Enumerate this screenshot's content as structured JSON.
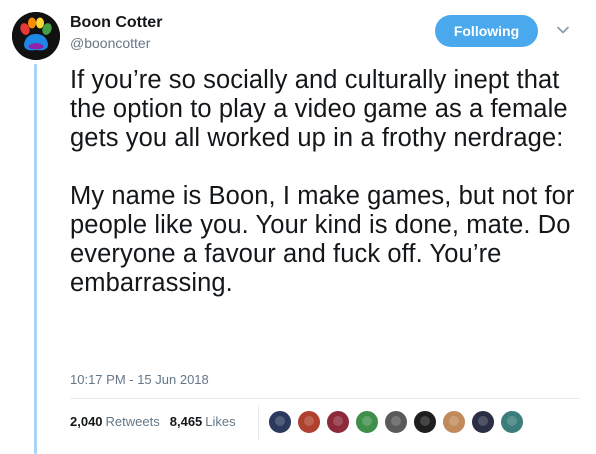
{
  "user": {
    "name": "Boon Cotter",
    "handle": "@booncotter"
  },
  "follow_button_label": "Following",
  "tweet": {
    "text": "If you’re so socially and culturally inept that the option to play a video game as a female gets you all worked up in a frothy nerdrage:\n\nMy name is Boon, I make games, but not for people like you. Your kind is done, mate. Do everyone a favour and fuck off. You’re embarrassing.",
    "timestamp": "10:17 PM - 15 Jun 2018"
  },
  "stats": {
    "retweets_count": "2,040",
    "retweets_label": "Retweets",
    "likes_count": "8,465",
    "likes_label": "Likes"
  },
  "likers": [
    {
      "icon": "liker-avatar-1",
      "color": "#2b3a5c"
    },
    {
      "icon": "liker-avatar-2",
      "color": "#b0412e"
    },
    {
      "icon": "liker-avatar-3",
      "color": "#8c2a3a"
    },
    {
      "icon": "liker-avatar-4",
      "color": "#3f8f4a"
    },
    {
      "icon": "liker-avatar-5",
      "color": "#5a5a5a"
    },
    {
      "icon": "liker-avatar-6",
      "color": "#1e1e1e"
    },
    {
      "icon": "liker-avatar-7",
      "color": "#c08a5a"
    },
    {
      "icon": "liker-avatar-8",
      "color": "#2a2f45"
    },
    {
      "icon": "liker-avatar-9",
      "color": "#3a7d7a"
    }
  ],
  "colors": {
    "accent": "#4aa8ec",
    "thread_line": "#a9d4f5",
    "muted_text": "#657786"
  }
}
